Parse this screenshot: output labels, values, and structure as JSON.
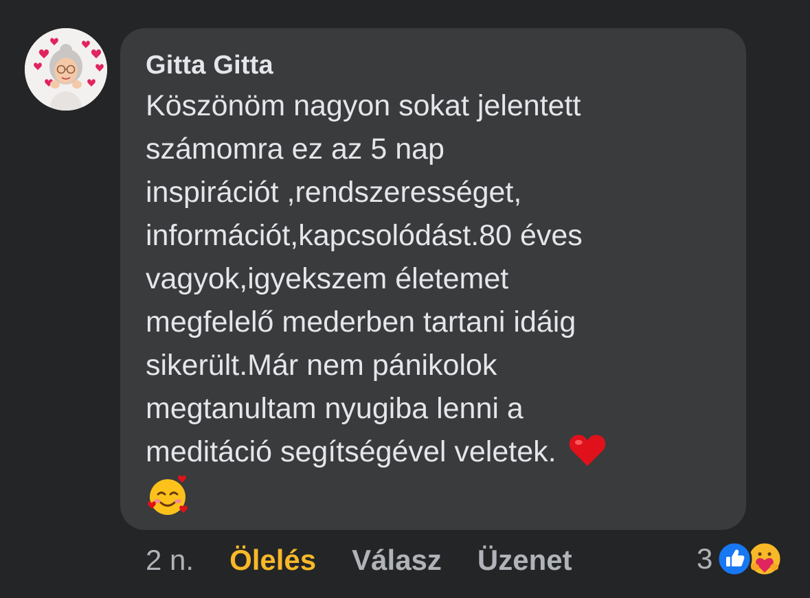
{
  "comment": {
    "author": "Gitta Gitta",
    "lines": [
      "Köszönöm nagyon sokat jelentett",
      "számomra  ez az 5 nap",
      "inspirációt ,rendszerességet,",
      "információt,kapcsolódást.80 éves",
      "vagyok,igyekszem életemet",
      "megfelelő mederben tartani idáig",
      "sikerült.Már nem pánikolok",
      "megtanultam nyugiba lenni a",
      "meditáció segítségével veletek."
    ],
    "emojis": [
      "❤️",
      "🥰"
    ]
  },
  "actions": {
    "time": "2 n.",
    "hug": "Ölelés",
    "reply": "Válasz",
    "message": "Üzenet"
  },
  "reactions": {
    "count": "3",
    "icons": [
      "like-icon",
      "care-icon"
    ]
  },
  "colors": {
    "background": "#242526",
    "bubble": "#3a3b3c",
    "text": "#e4e6eb",
    "muted": "#b0b3b8",
    "hug_accent": "#f7b928",
    "like_blue": "#1877f2"
  }
}
